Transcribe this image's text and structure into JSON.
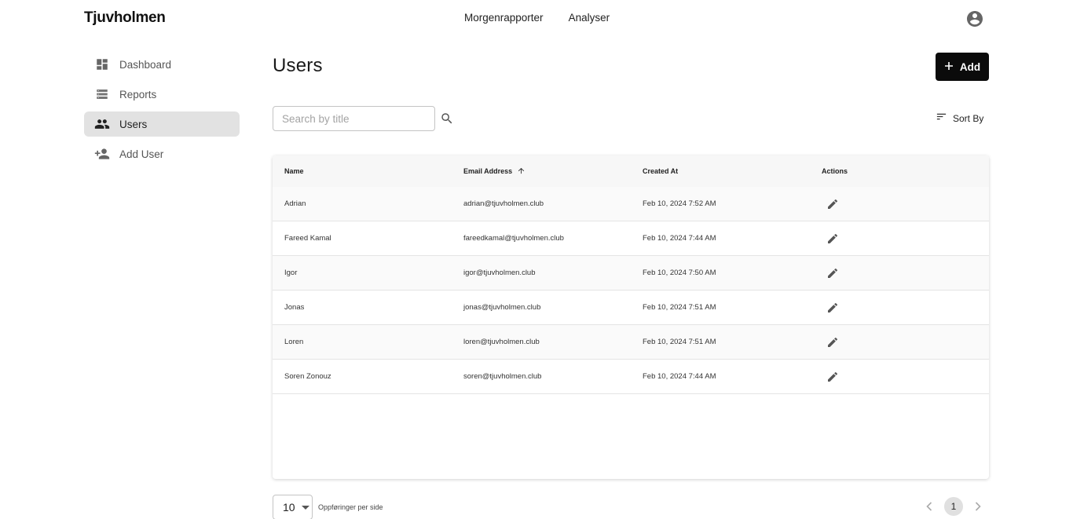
{
  "brand": {
    "logo": "Tjuvholmen"
  },
  "topnav": {
    "items": [
      "Morgenrapporter",
      "Analyser"
    ]
  },
  "sidebar": {
    "items": [
      {
        "label": "Dashboard",
        "icon": "dashboard-icon"
      },
      {
        "label": "Reports",
        "icon": "list-icon"
      },
      {
        "label": "Users",
        "icon": "people-icon",
        "active": true
      },
      {
        "label": "Add User",
        "icon": "person-add-icon"
      }
    ]
  },
  "page": {
    "title": "Users"
  },
  "toolbar": {
    "add_label": "Add",
    "sort_label": "Sort By"
  },
  "search": {
    "placeholder": "Search by title",
    "value": ""
  },
  "table": {
    "headers": {
      "name": "Name",
      "email": "Email Address",
      "created": "Created At",
      "actions": "Actions"
    },
    "sort_column": "Email Address",
    "sort_direction": "ascending",
    "rows": [
      {
        "name": "Adrian",
        "email": "adrian@tjuvholmen.club",
        "created": "Feb 10, 2024 7:52 AM"
      },
      {
        "name": "Fareed Kamal",
        "email": "fareedkamal@tjuvholmen.club",
        "created": "Feb 10, 2024 7:44 AM"
      },
      {
        "name": "Igor",
        "email": "igor@tjuvholmen.club",
        "created": "Feb 10, 2024 7:50 AM"
      },
      {
        "name": "Jonas",
        "email": "jonas@tjuvholmen.club",
        "created": "Feb 10, 2024 7:51 AM"
      },
      {
        "name": "Loren",
        "email": "loren@tjuvholmen.club",
        "created": "Feb 10, 2024 7:51 AM"
      },
      {
        "name": "Soren Zonouz",
        "email": "soren@tjuvholmen.club",
        "created": "Feb 10, 2024 7:44 AM"
      }
    ]
  },
  "pagination": {
    "per_page": "10",
    "per_page_label": "Oppføringer per side",
    "current_page": "1"
  },
  "colors": {
    "primary_button": "#0b0b0b",
    "active_nav": "#e2e2e2",
    "icon": "#555555"
  }
}
